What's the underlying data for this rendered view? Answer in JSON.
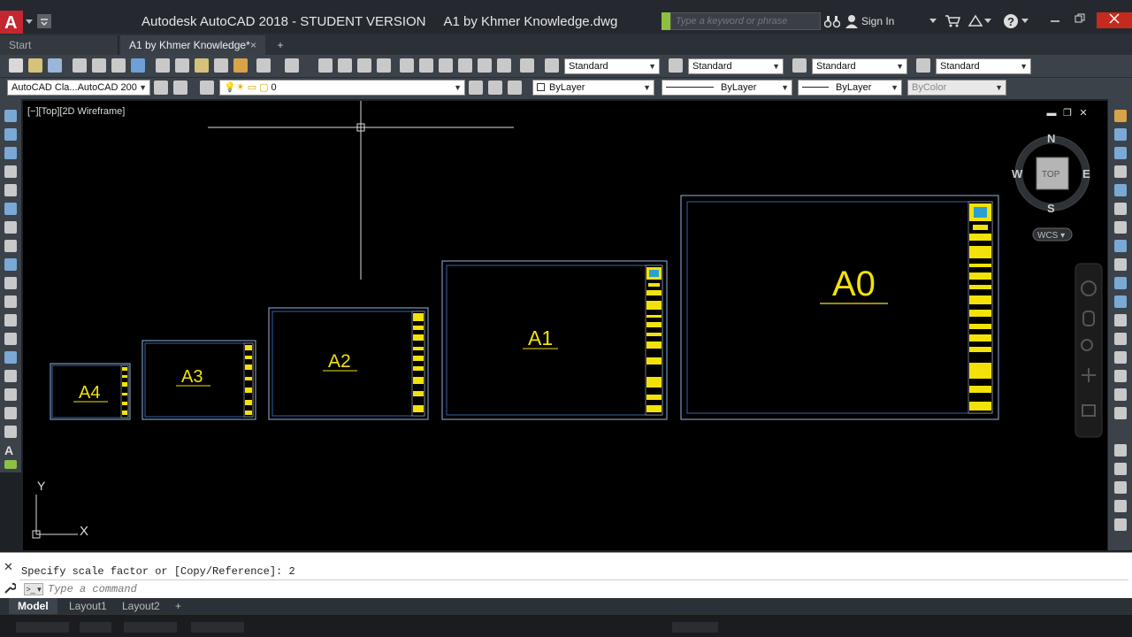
{
  "app": {
    "logo_letter": "A",
    "title": "Autodesk AutoCAD 2018 - STUDENT VERSION     A1 by Khmer Knowledge.dwg",
    "search_placeholder": "Type a keyword or phrase",
    "sign_in_label": "Sign In",
    "help_label": "?"
  },
  "document_tabs": [
    {
      "label": "Start"
    },
    {
      "label": "A1 by Khmer Knowledge*",
      "close": "×"
    },
    {
      "label": "+"
    }
  ],
  "toolbar1": {
    "text_style": "Standard",
    "dim_style": "Standard",
    "table_style": "Standard",
    "mleader_style": "Standard"
  },
  "toolbar2": {
    "workspace": "AutoCAD Cla...AutoCAD 200",
    "layer": "0",
    "color": "ByLayer",
    "linetype": "ByLayer",
    "lineweight": "ByLayer",
    "plotstyle": "ByColor"
  },
  "viewport": {
    "label": "[−][Top][2D Wireframe]",
    "controls": [
      "▬",
      "❐",
      "✕"
    ]
  },
  "viewcube": {
    "north": "N",
    "south": "S",
    "east": "E",
    "west": "W",
    "top": "TOP",
    "wcs": "WCS ▾"
  },
  "drawing": {
    "sheets": [
      {
        "label": "A4"
      },
      {
        "label": "A3"
      },
      {
        "label": "A2"
      },
      {
        "label": "A1"
      },
      {
        "label": "A0"
      }
    ],
    "ucs_x": "X",
    "ucs_y": "Y"
  },
  "command": {
    "history": "Specify scale factor or [Copy/Reference]: 2",
    "placeholder": "Type a command",
    "close": "✕",
    "prompt_icon": ">_ ▾"
  },
  "layout_tabs": [
    {
      "label": "Model"
    },
    {
      "label": "Layout1"
    },
    {
      "label": "Layout2"
    },
    {
      "label": "+"
    }
  ]
}
